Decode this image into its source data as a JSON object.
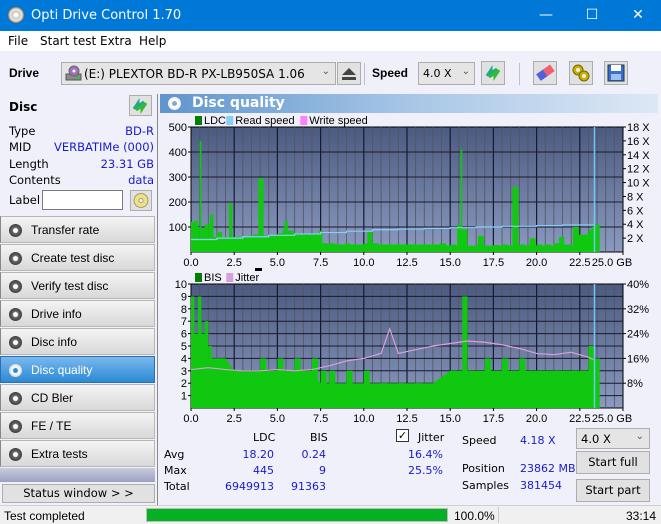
{
  "window": {
    "title": "Opti Drive Control 1.70",
    "minimize": "—",
    "maximize": "☐",
    "close": "✕"
  },
  "menu": [
    "File",
    "Start test",
    "Extra",
    "Help"
  ],
  "toolbar": {
    "drive_label": "Drive",
    "drive_value": "(E:)  PLEXTOR BD-R  PX-LB950SA 1.06",
    "speed_label": "Speed",
    "speed_value": "4.0 X",
    "icons": [
      "drive-icon",
      "eject-icon",
      "refresh-icon",
      "erase-icon",
      "settings-icon",
      "save-icon"
    ]
  },
  "disc": {
    "header": "Disc",
    "rows": [
      {
        "key": "Type",
        "value": "BD-R"
      },
      {
        "key": "MID",
        "value": "VERBATIMe (000)"
      },
      {
        "key": "Length",
        "value": "23.31 GB"
      },
      {
        "key": "Contents",
        "value": "data"
      }
    ],
    "label_key": "Label",
    "label_value": ""
  },
  "nav": [
    {
      "label": "Transfer rate",
      "active": false
    },
    {
      "label": "Create test disc",
      "active": false
    },
    {
      "label": "Verify test disc",
      "active": false
    },
    {
      "label": "Drive info",
      "active": false
    },
    {
      "label": "Disc info",
      "active": false
    },
    {
      "label": "Disc quality",
      "active": true
    },
    {
      "label": "CD Bler",
      "active": false
    },
    {
      "label": "FE / TE",
      "active": false
    },
    {
      "label": "Extra tests",
      "active": false
    }
  ],
  "status_window_label": "Status window > >",
  "panel_title": "Disc quality",
  "chart_data": [
    {
      "type": "bar",
      "title": "LDC",
      "legend": [
        {
          "name": "LDC",
          "color": "#008000"
        },
        {
          "name": "Read speed",
          "color": "#87cefa"
        },
        {
          "name": "Write speed",
          "color": "#ff80ff"
        }
      ],
      "legend_position": "top-left",
      "xlabel": "GB",
      "xlim": [
        0,
        25
      ],
      "x_ticks": [
        "0.0",
        "2.5",
        "5.0",
        "7.5",
        "10.0",
        "12.5",
        "15.0",
        "17.5",
        "20.0",
        "22.5",
        "25.0 GB"
      ],
      "ylim": [
        0,
        500
      ],
      "y_ticks": [
        "100",
        "200",
        "300",
        "400",
        "500"
      ],
      "y2lim": [
        0,
        18
      ],
      "y2_ticks": [
        "2 X",
        "4 X",
        "6 X",
        "8 X",
        "10 X",
        "12 X",
        "14 X",
        "16 X",
        "18 X"
      ],
      "grid": true,
      "series": [
        {
          "name": "LDC",
          "x": [
            0.0,
            0.2,
            0.4,
            0.5,
            0.6,
            0.8,
            1.0,
            1.1,
            1.3,
            1.5,
            1.8,
            2.0,
            2.2,
            2.4,
            2.7,
            3.0,
            3.3,
            3.6,
            3.8,
            3.9,
            4.2,
            4.6,
            5.0,
            5.3,
            5.4,
            5.6,
            6.0,
            6.5,
            7.0,
            7.4,
            7.6,
            8.0,
            8.5,
            8.9,
            9.2,
            9.6,
            10.0,
            10.2,
            10.5,
            11.0,
            11.5,
            12.0,
            12.4,
            13.0,
            13.5,
            14.0,
            14.4,
            15.0,
            15.4,
            15.6,
            15.7,
            16.0,
            16.5,
            16.6,
            17.0,
            17.5,
            18.0,
            18.5,
            18.6,
            19.0,
            19.5,
            19.6,
            20.0,
            20.5,
            21.0,
            21.3,
            21.6,
            22.0,
            22.1,
            22.5,
            22.8,
            23.0,
            23.2,
            23.3
          ],
          "y": [
            120,
            125,
            100,
            445,
            95,
            110,
            115,
            150,
            60,
            80,
            55,
            60,
            195,
            60,
            55,
            60,
            65,
            70,
            70,
            295,
            65,
            60,
            75,
            90,
            125,
            85,
            75,
            70,
            70,
            85,
            35,
            35,
            30,
            35,
            30,
            28,
            35,
            80,
            35,
            30,
            25,
            22,
            30,
            20,
            25,
            20,
            35,
            30,
            110,
            410,
            90,
            25,
            30,
            65,
            25,
            28,
            30,
            25,
            260,
            30,
            30,
            55,
            30,
            30,
            35,
            60,
            30,
            25,
            100,
            35,
            60,
            90,
            100,
            110
          ]
        },
        {
          "name": "Read speed",
          "x": [
            0.0,
            1.5,
            3.0,
            4.5,
            6.0,
            7.5,
            9.0,
            10.5,
            12.0,
            13.5,
            15.0,
            16.5,
            18.0,
            20.0,
            21.5,
            23.3
          ],
          "y": [
            1.8,
            2.0,
            2.2,
            2.4,
            2.6,
            2.8,
            3.0,
            3.2,
            3.3,
            3.4,
            3.5,
            3.6,
            3.7,
            3.8,
            3.9,
            4.0
          ]
        }
      ]
    },
    {
      "type": "bar",
      "title": "BIS",
      "legend": [
        {
          "name": "BIS",
          "color": "#008000"
        },
        {
          "name": "Jitter",
          "color": "#d8a0d8"
        }
      ],
      "legend_position": "top-left",
      "xlabel": "GB",
      "xlim": [
        0,
        25
      ],
      "x_ticks": [
        "0.0",
        "2.5",
        "5.0",
        "7.5",
        "10.0",
        "12.5",
        "15.0",
        "17.5",
        "20.0",
        "22.5",
        "25.0 GB"
      ],
      "ylim": [
        0,
        10
      ],
      "y_ticks": [
        "1",
        "2",
        "3",
        "4",
        "5",
        "6",
        "7",
        "8",
        "9",
        "10"
      ],
      "y2lim": [
        0,
        40
      ],
      "y2_ticks": [
        "8%",
        "16%",
        "24%",
        "32%",
        "40%"
      ],
      "grid": true,
      "series": [
        {
          "name": "BIS",
          "x": [
            0.0,
            0.2,
            0.4,
            0.6,
            0.8,
            1.0,
            1.2,
            1.5,
            2.0,
            2.5,
            3.0,
            4.0,
            5.0,
            6.0,
            7.0,
            7.5,
            8.0,
            9.0,
            10.0,
            11.0,
            12.0,
            13.0,
            14.0,
            15.0,
            15.7,
            16.0,
            17.0,
            18.0,
            19.0,
            20.0,
            21.0,
            22.0,
            22.5,
            23.0,
            23.3
          ],
          "y": [
            9,
            6,
            9,
            6,
            7,
            5,
            4,
            4,
            3,
            3,
            3,
            4,
            4,
            4,
            4,
            3,
            3,
            3,
            3,
            2,
            2,
            2,
            2,
            3,
            9,
            3,
            4,
            4,
            4,
            3,
            3,
            3,
            3,
            5,
            4
          ]
        },
        {
          "name": "Jitter",
          "x": [
            0,
            1,
            2,
            3,
            4,
            5,
            6,
            7,
            8,
            9,
            10,
            11,
            11.5,
            12,
            13,
            14,
            15,
            16,
            17,
            18,
            19,
            20,
            21,
            22,
            23,
            23.3
          ],
          "y": [
            12.4,
            13.0,
            12.4,
            12.0,
            12.0,
            12.4,
            12.0,
            12.4,
            13.6,
            15.2,
            16.0,
            17.6,
            25.5,
            17.6,
            18.8,
            20.0,
            20.8,
            21.6,
            21.2,
            20.4,
            19.2,
            17.6,
            17.2,
            18.0,
            16.4,
            15.6
          ]
        }
      ]
    }
  ],
  "stats": {
    "col_ldc": "LDC",
    "col_bis": "BIS",
    "jitter_checked": true,
    "jitter_label": "Jitter",
    "avg_label": "Avg",
    "max_label": "Max",
    "total_label": "Total",
    "ldc_avg": "18.20",
    "ldc_max": "445",
    "ldc_total": "6949913",
    "bis_avg": "0.24",
    "bis_max": "9",
    "bis_total": "91363",
    "jitter_avg": "16.4%",
    "jitter_max": "25.5%",
    "speed_label": "Speed",
    "speed_value": "4.18 X",
    "position_label": "Position",
    "position_value": "23862 MB",
    "samples_label": "Samples",
    "samples_value": "381454",
    "speed_select": "4.0 X",
    "start_full": "Start full",
    "start_part": "Start part"
  },
  "statusbar": {
    "text": "Test completed",
    "progress": 100.0,
    "progress_text": "100.0%",
    "time": "33:14"
  }
}
